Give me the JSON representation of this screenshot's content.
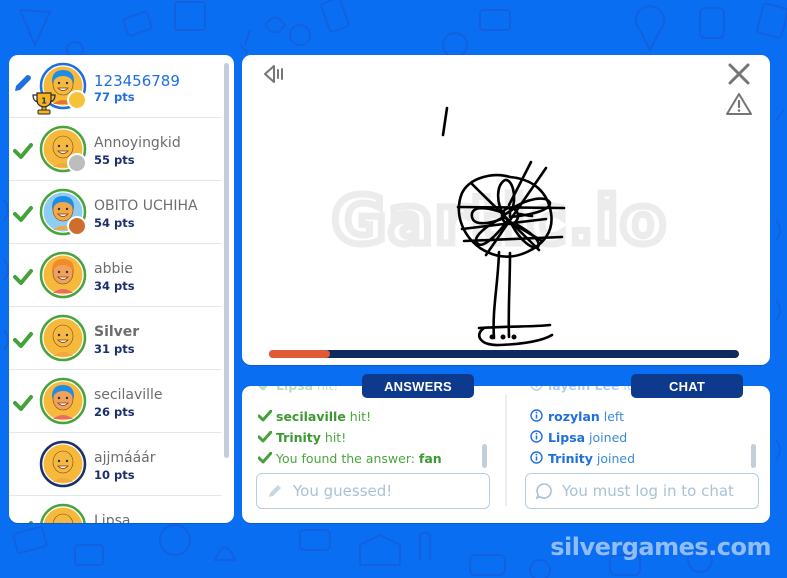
{
  "colors": {
    "background": "#0a6ef2",
    "accent_blue": "#1f6fe0",
    "navy": "#0d3a8c",
    "hit_green": "#49a73c",
    "progress_fill": "#e25a35",
    "progress_track": "#0d2b5e"
  },
  "players": [
    {
      "name": "123456789",
      "points": "77 pts",
      "status": "drawing",
      "rank_badge": "1",
      "is_me": true,
      "ring": "#1f6fe0",
      "medal": "#f5c23a"
    },
    {
      "name": "Annoyingkid",
      "points": "55 pts",
      "status": "guessed",
      "ring": "#4aa33d",
      "medal": "#bdbdbd"
    },
    {
      "name": "OBITO UCHIHA",
      "points": "54 pts",
      "status": "guessed",
      "ring": "#4aa33d",
      "medal": "#cf6e2c"
    },
    {
      "name": "abbie",
      "points": "34 pts",
      "status": "guessed",
      "ring": "#4aa33d"
    },
    {
      "name": "Silver",
      "points": "31 pts",
      "status": "guessed",
      "ring": "#4aa33d"
    },
    {
      "name": "secilaville",
      "points": "26 pts",
      "status": "guessed",
      "ring": "#4aa33d"
    },
    {
      "name": "ajjmááár",
      "points": "10 pts",
      "status": "none",
      "ring": "#1b2f6b"
    },
    {
      "name": "Lipsa",
      "points": "",
      "status": "guessed",
      "ring": "#4aa33d"
    }
  ],
  "canvas": {
    "watermark": "Gartic.io",
    "progress": 0.13,
    "icons": {
      "sound": "speaker-icon",
      "close": "close-icon",
      "report": "warning-icon"
    }
  },
  "tabs": {
    "answers": "ANSWERS",
    "chat": "CHAT"
  },
  "answers": {
    "messages": [
      {
        "user": "Lipsa",
        "text": " hit!",
        "faded": true
      },
      {
        "user": "secilaville",
        "text": " hit!"
      },
      {
        "user": "Trinity",
        "text": " hit!"
      },
      {
        "prefix": "You found the answer: ",
        "user": "fan"
      }
    ],
    "input_placeholder": "You guessed!"
  },
  "chat": {
    "messages": [
      {
        "user": "layein Lee",
        "text": " left",
        "faded": true
      },
      {
        "user": "rozylan",
        "text": " left"
      },
      {
        "user": "Lipsa",
        "text": " joined"
      },
      {
        "user": "Trinity",
        "text": " joined"
      }
    ],
    "input_placeholder": "You must log in to chat"
  },
  "site_brand": "silvergames.com"
}
